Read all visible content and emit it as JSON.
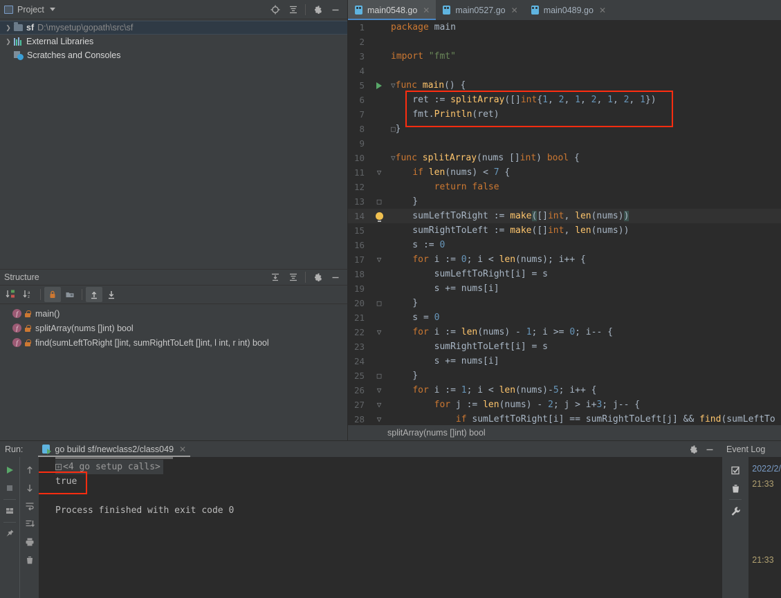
{
  "project": {
    "title": "Project",
    "icons": [
      "locate-icon",
      "collapse-all-icon",
      "gear-icon",
      "minimize-icon"
    ],
    "tree": [
      {
        "name": "sf",
        "path": "D:\\mysetup\\gopath\\src\\sf",
        "icon": "folder-icon",
        "expandable": true,
        "selected": true
      },
      {
        "name": "External Libraries",
        "path": "",
        "icon": "library-icon",
        "expandable": true,
        "selected": false
      },
      {
        "name": "Scratches and Consoles",
        "path": "",
        "icon": "scratches-icon",
        "expandable": false,
        "selected": false
      }
    ]
  },
  "structure": {
    "title": "Structure",
    "header_icons": [
      "expand-all-icon",
      "collapse-all-icon",
      "gear-icon",
      "minimize-icon"
    ],
    "toolbar_icons": [
      "sort-by-visibility-icon",
      "sort-alphabetically-icon",
      "show-non-public-icon",
      "group-icon",
      "expand-all-icon",
      "collapse-all-icon"
    ],
    "items": [
      {
        "label": "main()",
        "kind": "f"
      },
      {
        "label": "splitArray(nums []int) bool",
        "kind": "f"
      },
      {
        "label": "find(sumLeftToRight []int, sumRightToLeft []int, l int, r int) bool",
        "kind": "f"
      }
    ]
  },
  "editor": {
    "tabs": [
      {
        "label": "main0548.go",
        "active": true
      },
      {
        "label": "main0527.go",
        "active": false
      },
      {
        "label": "main0489.go",
        "active": false
      }
    ],
    "breadcrumb": "splitArray(nums []int) bool",
    "lines": [
      {
        "n": "1",
        "text": "package main"
      },
      {
        "n": "2",
        "text": ""
      },
      {
        "n": "3",
        "text": "import \"fmt\""
      },
      {
        "n": "4",
        "text": ""
      },
      {
        "n": "5",
        "text": "func main() {"
      },
      {
        "n": "6",
        "text": "    ret := splitArray([]int{1, 2, 1, 2, 1, 2, 1})"
      },
      {
        "n": "7",
        "text": "    fmt.Println(ret)"
      },
      {
        "n": "8",
        "text": "}"
      },
      {
        "n": "9",
        "text": ""
      },
      {
        "n": "10",
        "text": "func splitArray(nums []int) bool {"
      },
      {
        "n": "11",
        "text": "    if len(nums) < 7 {"
      },
      {
        "n": "12",
        "text": "        return false"
      },
      {
        "n": "13",
        "text": "    }"
      },
      {
        "n": "14",
        "text": "    sumLeftToRight := make([]int, len(nums))"
      },
      {
        "n": "15",
        "text": "    sumRightToLeft := make([]int, len(nums))"
      },
      {
        "n": "16",
        "text": "    s := 0"
      },
      {
        "n": "17",
        "text": "    for i := 0; i < len(nums); i++ {"
      },
      {
        "n": "18",
        "text": "        sumLeftToRight[i] = s"
      },
      {
        "n": "19",
        "text": "        s += nums[i]"
      },
      {
        "n": "20",
        "text": "    }"
      },
      {
        "n": "21",
        "text": "    s = 0"
      },
      {
        "n": "22",
        "text": "    for i := len(nums) - 1; i >= 0; i-- {"
      },
      {
        "n": "23",
        "text": "        sumRightToLeft[i] = s"
      },
      {
        "n": "24",
        "text": "        s += nums[i]"
      },
      {
        "n": "25",
        "text": "    }"
      },
      {
        "n": "26",
        "text": "    for i := 1; i < len(nums)-5; i++ {"
      },
      {
        "n": "27",
        "text": "        for j := len(nums) - 2; j > i+3; j-- {"
      },
      {
        "n": "28",
        "text": "            if sumLeftToRight[i] == sumRightToLeft[j] && find(sumLeftTo"
      }
    ]
  },
  "run": {
    "label": "Run:",
    "tab_label": "go build sf/newclass2/class049",
    "header_icons": [
      "gear-icon",
      "minimize-icon"
    ],
    "left_icons": [
      "rerun-icon",
      "stop-icon",
      "layout-icon",
      "pin-icon"
    ],
    "mid_icons": [
      "up-arrow-icon",
      "down-arrow-icon",
      "soft-wrap-icon",
      "scroll-to-end-icon",
      "print-icon",
      "trash-icon"
    ],
    "console": [
      {
        "text": "<4 go setup calls>",
        "style": "fold"
      },
      {
        "text": "true",
        "style": "normal"
      },
      {
        "text": "",
        "style": "normal"
      },
      {
        "text": "Process finished with exit code 0",
        "style": "normal"
      }
    ]
  },
  "event_log": {
    "title": "Event Log",
    "icons": [
      "mark-read-icon",
      "trash-icon",
      "settings-wrench-icon"
    ],
    "entries": [
      {
        "text": "2022/2/"
      },
      {
        "text": "21:33"
      },
      {
        "text": "21:33"
      }
    ]
  },
  "annotations": {
    "color": "#ff2d10",
    "boxes": [
      "code-highlight-box",
      "console-output-box"
    ]
  }
}
